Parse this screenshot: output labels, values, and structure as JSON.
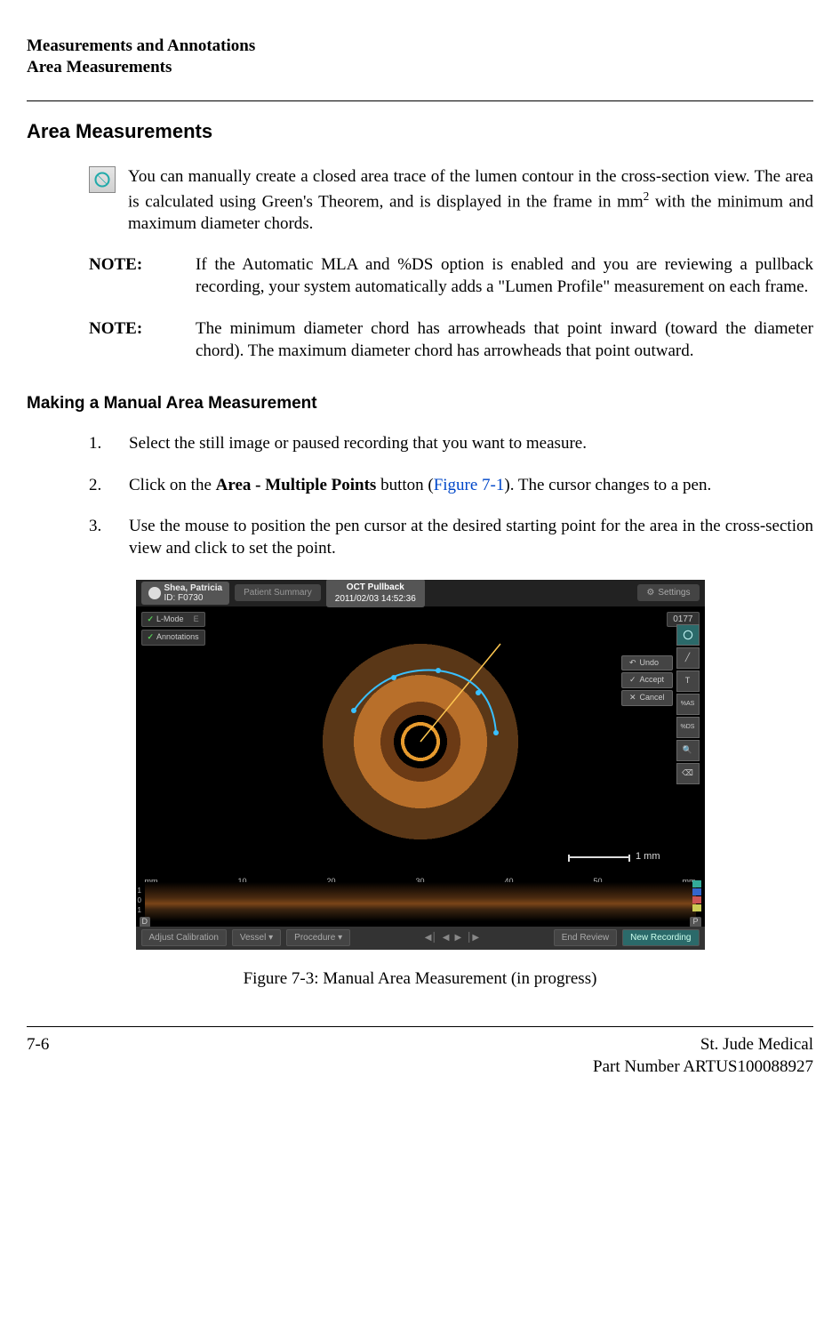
{
  "header": {
    "line1": "Measurements and Annotations",
    "line2": "Area Measurements"
  },
  "section_title": "Area Measurements",
  "intro": {
    "text_before_sup": "You can manually create a closed area trace of the lumen contour in the cross-section view. The area is calculated using Green's Theorem, and is displayed in the frame in mm",
    "sup": "2",
    "text_after_sup": " with the minimum and maximum diameter chords."
  },
  "notes": [
    {
      "label": "NOTE:",
      "body": "If the Automatic MLA and %DS option is enabled and you are reviewing a pullback recording, your system automatically adds a \"Lumen Profile\" measurement on each frame."
    },
    {
      "label": "NOTE:",
      "body": "The minimum diameter chord has arrowheads that point inward (toward the diameter chord). The maximum diameter chord has arrowheads that point outward."
    }
  ],
  "subsection_title": "Making a Manual Area Measurement",
  "steps": [
    {
      "num": "1.",
      "body_plain": "Select the still image or paused recording that you want to measure."
    },
    {
      "num": "2.",
      "pre": "Click on the ",
      "bold": "Area - Multiple Points",
      "mid": " button (",
      "figref": "Figure 7-1",
      "post": "). The cursor changes to a pen."
    },
    {
      "num": "3.",
      "body_plain": "Use the mouse to position the pen cursor at the desired starting point for the area in the cross-section view and click to set the point."
    }
  ],
  "screenshot": {
    "patient_name": "Shea, Patricia",
    "patient_id": "ID: F0730",
    "tab_summary": "Patient Summary",
    "tab_active_title": "OCT Pullback",
    "tab_active_sub": "2011/02/03 14:52:36",
    "settings": "Settings",
    "lmode_btn": "L-Mode",
    "lmode_btn_suffix": "E",
    "annotations_btn": "Annotations",
    "frame_count": "0177",
    "undo": "Undo",
    "accept": "Accept",
    "cancel": "Cancel",
    "tool_text": "T",
    "tool_pct_as": "%AS",
    "tool_pct_ds": "%DS",
    "scale_label": "1 mm",
    "ruler": [
      "mm",
      "10",
      "20",
      "30",
      "40",
      "50",
      "mm"
    ],
    "ruler_left_vals": [
      "1",
      "0",
      "1"
    ],
    "bottom": {
      "adjust": "Adjust Calibration",
      "vessel": "Vessel",
      "procedure": "Procedure",
      "end": "End Review",
      "new": "New Recording",
      "d_marker": "D",
      "p_marker": "P"
    }
  },
  "figure_caption": "Figure 7-3:  Manual Area Measurement (in progress)",
  "footer": {
    "page": "7-6",
    "company": "St. Jude Medical",
    "partnum": "Part Number ARTUS100088927"
  }
}
